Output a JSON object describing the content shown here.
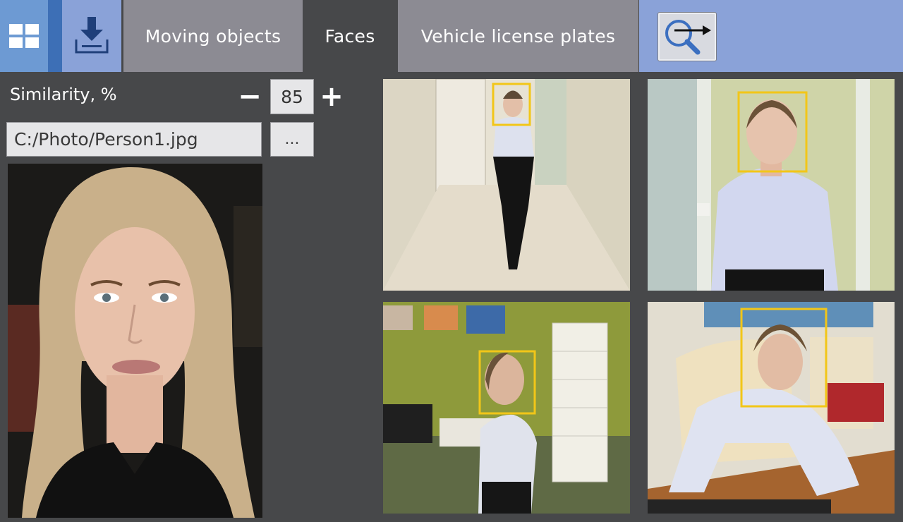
{
  "toolbar": {
    "grid_icon": "grid-icon",
    "download_icon": "download-icon",
    "search_icon": "search-arrow-icon",
    "accent": "#6d9ad3",
    "accent_dark": "#3d6fb6",
    "panel_blue": "#8aa2d8"
  },
  "tabs": [
    {
      "label": "Moving objects",
      "active": false
    },
    {
      "label": "Faces",
      "active": true
    },
    {
      "label": "Vehicle license plates",
      "active": false
    }
  ],
  "similarity": {
    "label": "Similarity, %",
    "minus": "−",
    "value": "85",
    "plus": "+"
  },
  "file": {
    "path": "C:/Photo/Person1.jpg",
    "browse_label": "..."
  },
  "results": {
    "highlight_color": "#f2c618"
  }
}
